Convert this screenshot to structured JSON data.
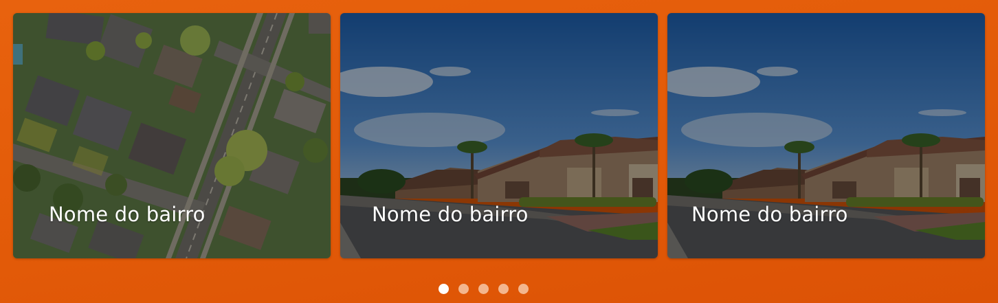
{
  "carousel": {
    "cards": [
      {
        "label": "Nome do bairro",
        "image": "aerial-neighborhood-photo"
      },
      {
        "label": "Nome do bairro",
        "image": "street-houses-photo"
      },
      {
        "label": "Nome do bairro",
        "image": "street-houses-photo"
      }
    ],
    "dots": {
      "count": 5,
      "active_index": 0
    }
  },
  "colors": {
    "background": "#e25a08",
    "dot_active": "#ffffff",
    "dot_inactive": "#f3b68e",
    "label_text": "#ffffff"
  }
}
